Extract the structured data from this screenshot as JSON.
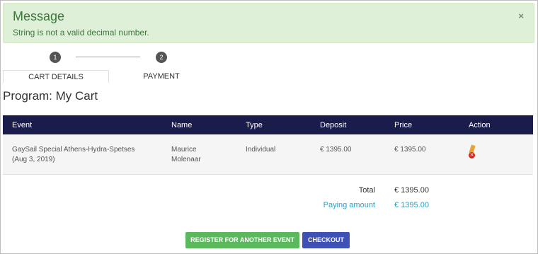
{
  "alert": {
    "title": "Message",
    "message": "String is not a valid decimal number.",
    "close_glyph": "×",
    "color": "#dff0d8"
  },
  "steps": [
    {
      "number": "1",
      "label": "CART DETAILS",
      "active": true
    },
    {
      "number": "2",
      "label": "PAYMENT",
      "active": false
    }
  ],
  "page_title": "Program: My Cart",
  "table": {
    "header_color": "#1a1c4b",
    "columns": [
      "Event",
      "Name",
      "Type",
      "Deposit",
      "Price",
      "Action"
    ],
    "rows": [
      {
        "event": "GaySail Special Athens-Hydra-Spetses",
        "event_date": "(Aug 3, 2019)",
        "name_first": "Maurice",
        "name_last": "Molenaar",
        "type": "Individual",
        "deposit": "€ 1395.00",
        "price": "€ 1395.00",
        "actions": [
          "pencil-icon",
          "remove-icon"
        ]
      }
    ]
  },
  "totals": {
    "total_label": "Total",
    "total_value": "€ 1395.00",
    "paying_label": "Paying amount",
    "paying_value": "€ 1395.00"
  },
  "buttons": {
    "register": "REGISTER FOR ANOTHER EVENT",
    "checkout": "CHECKOUT"
  }
}
